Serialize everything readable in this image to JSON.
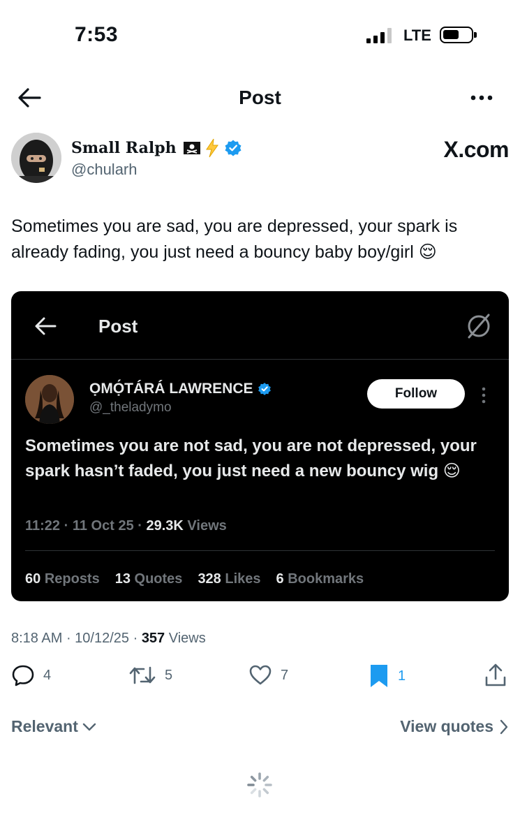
{
  "status_bar": {
    "time": "7:53",
    "network": "LTE"
  },
  "nav": {
    "title": "Post"
  },
  "author": {
    "display_name": "Small Ralph",
    "name_emojis": "🏴‍☠️⚡",
    "handle": "@chularh",
    "verified": true,
    "watermark": "X.com"
  },
  "post": {
    "text": "Sometimes you are sad, you are depressed, your spark is already fading, you just need a bouncy baby boy/girl 😌",
    "time": "8:18 AM",
    "date": "10/12/25",
    "views_count": "357",
    "views_label": "Views"
  },
  "embedded_post": {
    "header_title": "Post",
    "author_name": "ỌMỌ́TÁRÁ LAWRENCE",
    "author_handle": "@_theladymo",
    "follow_label": "Follow",
    "text": "Sometimes you are not sad, you are not depressed, your spark hasn’t faded, you just need a new bouncy wig 😌",
    "time": "11:22",
    "date": "11 Oct 25",
    "views_count": "29.3K",
    "views_label": "Views",
    "stats": [
      {
        "count": "60",
        "label": "Reposts"
      },
      {
        "count": "13",
        "label": "Quotes"
      },
      {
        "count": "328",
        "label": "Likes"
      },
      {
        "count": "6",
        "label": "Bookmarks"
      }
    ]
  },
  "actions": {
    "replies": "4",
    "reposts": "5",
    "likes": "7",
    "bookmarks": "1",
    "bookmark_color": "#1d9bf0"
  },
  "footer": {
    "sort_label": "Relevant",
    "view_quotes_label": "View quotes"
  },
  "colors": {
    "verified": "#1d9bf0",
    "muted": "#536471"
  }
}
